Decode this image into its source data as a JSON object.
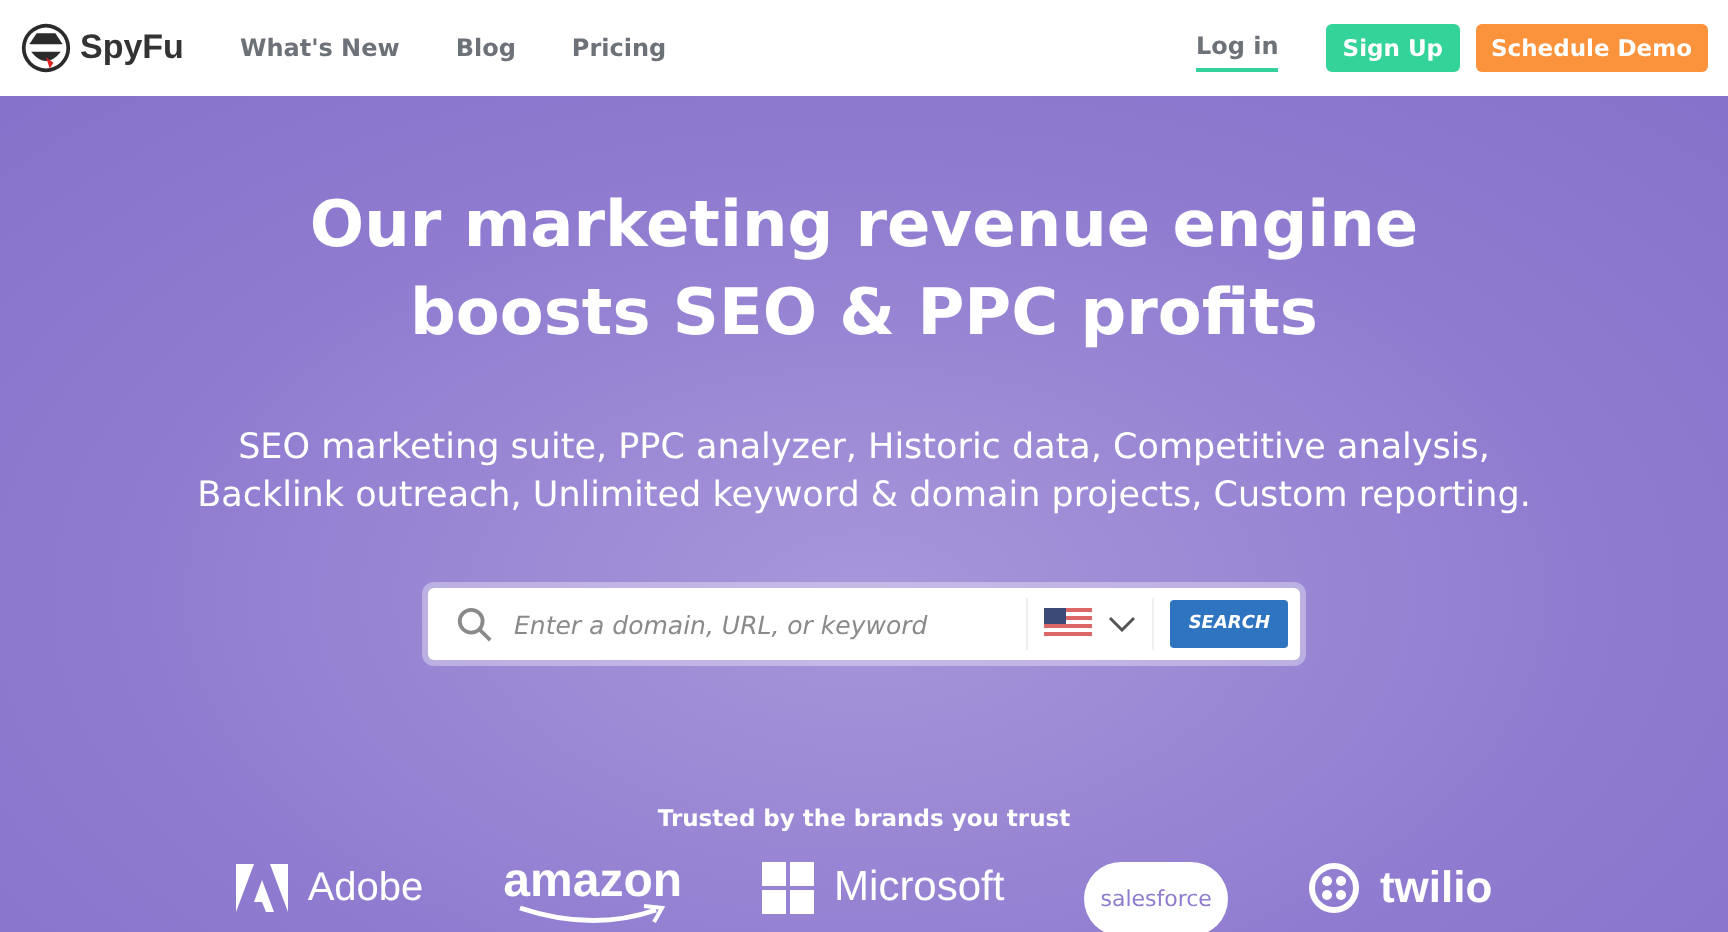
{
  "header": {
    "brand": "SpyFu",
    "nav": [
      {
        "label": "What's New"
      },
      {
        "label": "Blog"
      },
      {
        "label": "Pricing"
      }
    ],
    "login": {
      "label": "Log in",
      "selected": true
    },
    "signup": "Sign Up",
    "demo": "Schedule Demo"
  },
  "hero": {
    "title_lines": [
      "Our marketing revenue engine",
      "boosts SEO & PPC profits"
    ],
    "subtitle_lines": [
      "SEO marketing suite, PPC analyzer, Historic data, Competitive analysis,",
      "Backlink outreach, Unlimited keyword & domain projects, Custom reporting."
    ],
    "search": {
      "placeholder": "Enter a domain, URL, or keyword",
      "button": "SEARCH"
    }
  },
  "trusted": {
    "caption": "Trusted by the brands you trust",
    "brands": [
      {
        "kind": "adobe",
        "name": "Adobe"
      },
      {
        "kind": "amazon",
        "name": "amazon"
      },
      {
        "kind": "microsoft",
        "name": "Microsoft"
      },
      {
        "kind": "salesforce",
        "name": "salesforce"
      },
      {
        "kind": "twilio",
        "name": "twilio"
      }
    ]
  }
}
